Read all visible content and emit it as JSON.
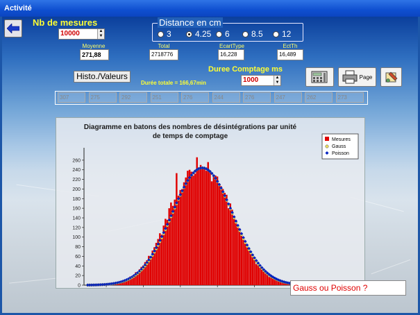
{
  "window": {
    "title": "Activité"
  },
  "nb_mesures": {
    "label": "Nb de mesures",
    "value": "10000"
  },
  "distance": {
    "title": "Distance en cm",
    "options": [
      "3",
      "4.25",
      "6",
      "8.5",
      "12"
    ],
    "selected": "4.25"
  },
  "stats": [
    {
      "label": "Moyenne",
      "value": "271,88"
    },
    {
      "label": "Total",
      "value": "2718776"
    },
    {
      "label": "EcartType",
      "value": "16,228"
    },
    {
      "label": "EctTh",
      "value": "16,489"
    }
  ],
  "histo_button": "Histo./Valeurs",
  "duree_totale": "Durée totale = 166,67min",
  "duree_comptage": {
    "label": "Duree Comptage ms",
    "value": "1000"
  },
  "icons": {
    "calculator": "calculator-icon",
    "printer": "printer-icon",
    "tools": "tools-icon"
  },
  "page_button": "Page",
  "values_row": [
    "307",
    "275",
    "292",
    "251",
    "276",
    "244",
    "276",
    "247",
    "262",
    "273"
  ],
  "gauss_text": "Gauss ou Poisson ?",
  "colors": {
    "bars": "#e00000",
    "gauss": "#f0e060",
    "poisson": "#0020c0",
    "label_yellow": "#ffff33"
  },
  "chart_data": {
    "type": "bar",
    "title": "Diagramme en batons des nombres de désintégrations par unité de temps de comptage",
    "legend": [
      "Mesures",
      "Gauss",
      "Poisson"
    ],
    "legend_position": "top-right",
    "xlim": [
      208,
      332
    ],
    "ylim": [
      0,
      280
    ],
    "xticks": [
      220,
      240,
      260,
      280,
      300,
      320
    ],
    "yticks": [
      0,
      20,
      40,
      60,
      80,
      100,
      120,
      140,
      160,
      180,
      200,
      220,
      240,
      260
    ],
    "grid": false,
    "mean": 271.88,
    "std": 16.228,
    "peak": 244,
    "x": [
      217,
      218,
      219,
      220,
      221,
      222,
      223,
      224,
      225,
      226,
      227,
      228,
      229,
      230,
      231,
      232,
      233,
      234,
      235,
      236,
      237,
      238,
      239,
      240,
      241,
      242,
      243,
      244,
      245,
      246,
      247,
      248,
      249,
      250,
      251,
      252,
      253,
      254,
      255,
      256,
      257,
      258,
      259,
      260,
      261,
      262,
      263,
      264,
      265,
      266,
      267,
      268,
      269,
      270,
      271,
      272,
      273,
      274,
      275,
      276,
      277,
      278,
      279,
      280,
      281,
      282,
      283,
      284,
      285,
      286,
      287,
      288,
      289,
      290,
      291,
      292,
      293,
      294,
      295,
      296,
      297,
      298,
      299,
      300,
      301,
      302,
      303,
      304,
      305,
      306,
      307,
      308,
      309,
      310,
      311,
      312,
      313,
      314,
      315,
      316,
      317,
      318,
      319,
      320,
      321,
      322,
      323,
      324,
      325,
      326,
      327,
      328,
      329,
      330
    ],
    "values": [
      1,
      1,
      1,
      2,
      2,
      1,
      3,
      3,
      4,
      6,
      5,
      7,
      9,
      11,
      10,
      14,
      18,
      17,
      22,
      27,
      26,
      33,
      38,
      41,
      48,
      52,
      61,
      58,
      72,
      79,
      88,
      96,
      108,
      105,
      124,
      138,
      136,
      160,
      172,
      165,
      178,
      233,
      186,
      198,
      200,
      214,
      224,
      238,
      240,
      236,
      228,
      232,
      266,
      243,
      250,
      244,
      243,
      238,
      256,
      236,
      216,
      225,
      228,
      226,
      212,
      206,
      200,
      192,
      188,
      160,
      170,
      157,
      144,
      136,
      122,
      118,
      106,
      98,
      90,
      80,
      72,
      66,
      58,
      52,
      44,
      41,
      36,
      32,
      28,
      24,
      22,
      17,
      16,
      14,
      12,
      10,
      8,
      7,
      6,
      5,
      4,
      4,
      3,
      2,
      2,
      2,
      1,
      1,
      1,
      1,
      0,
      1,
      0,
      0
    ]
  }
}
